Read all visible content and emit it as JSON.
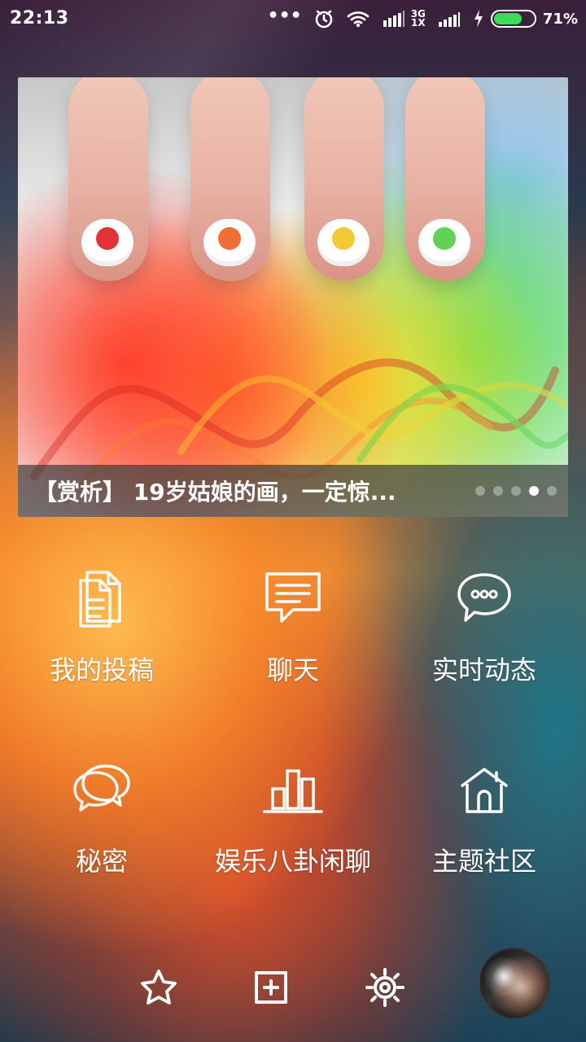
{
  "status_bar": {
    "time": "22:13",
    "network_top": "3G",
    "network_bottom": "1X",
    "battery_percent_text": "71%",
    "battery_level": 0.71
  },
  "banner": {
    "caption": "【赏析】 19岁姑娘的画，一定惊...",
    "pager": {
      "count": 5,
      "active_index": 3
    }
  },
  "menu": {
    "items": [
      {
        "label": "我的投稿",
        "icon": "documents-icon"
      },
      {
        "label": "聊天",
        "icon": "chat-bubble-icon"
      },
      {
        "label": "实时动态",
        "icon": "ellipsis-bubble-icon"
      },
      {
        "label": "秘密",
        "icon": "double-bubble-icon"
      },
      {
        "label": "娱乐八卦闲聊",
        "icon": "bar-chart-icon"
      },
      {
        "label": "主题社区",
        "icon": "home-icon"
      }
    ]
  },
  "bottom_nav": {
    "items": [
      {
        "icon": "star-icon"
      },
      {
        "icon": "add-post-icon"
      },
      {
        "icon": "settings-icon"
      }
    ]
  },
  "colors": {
    "battery_fill": "#3ddc55",
    "icon_stroke": "#ffffff"
  }
}
